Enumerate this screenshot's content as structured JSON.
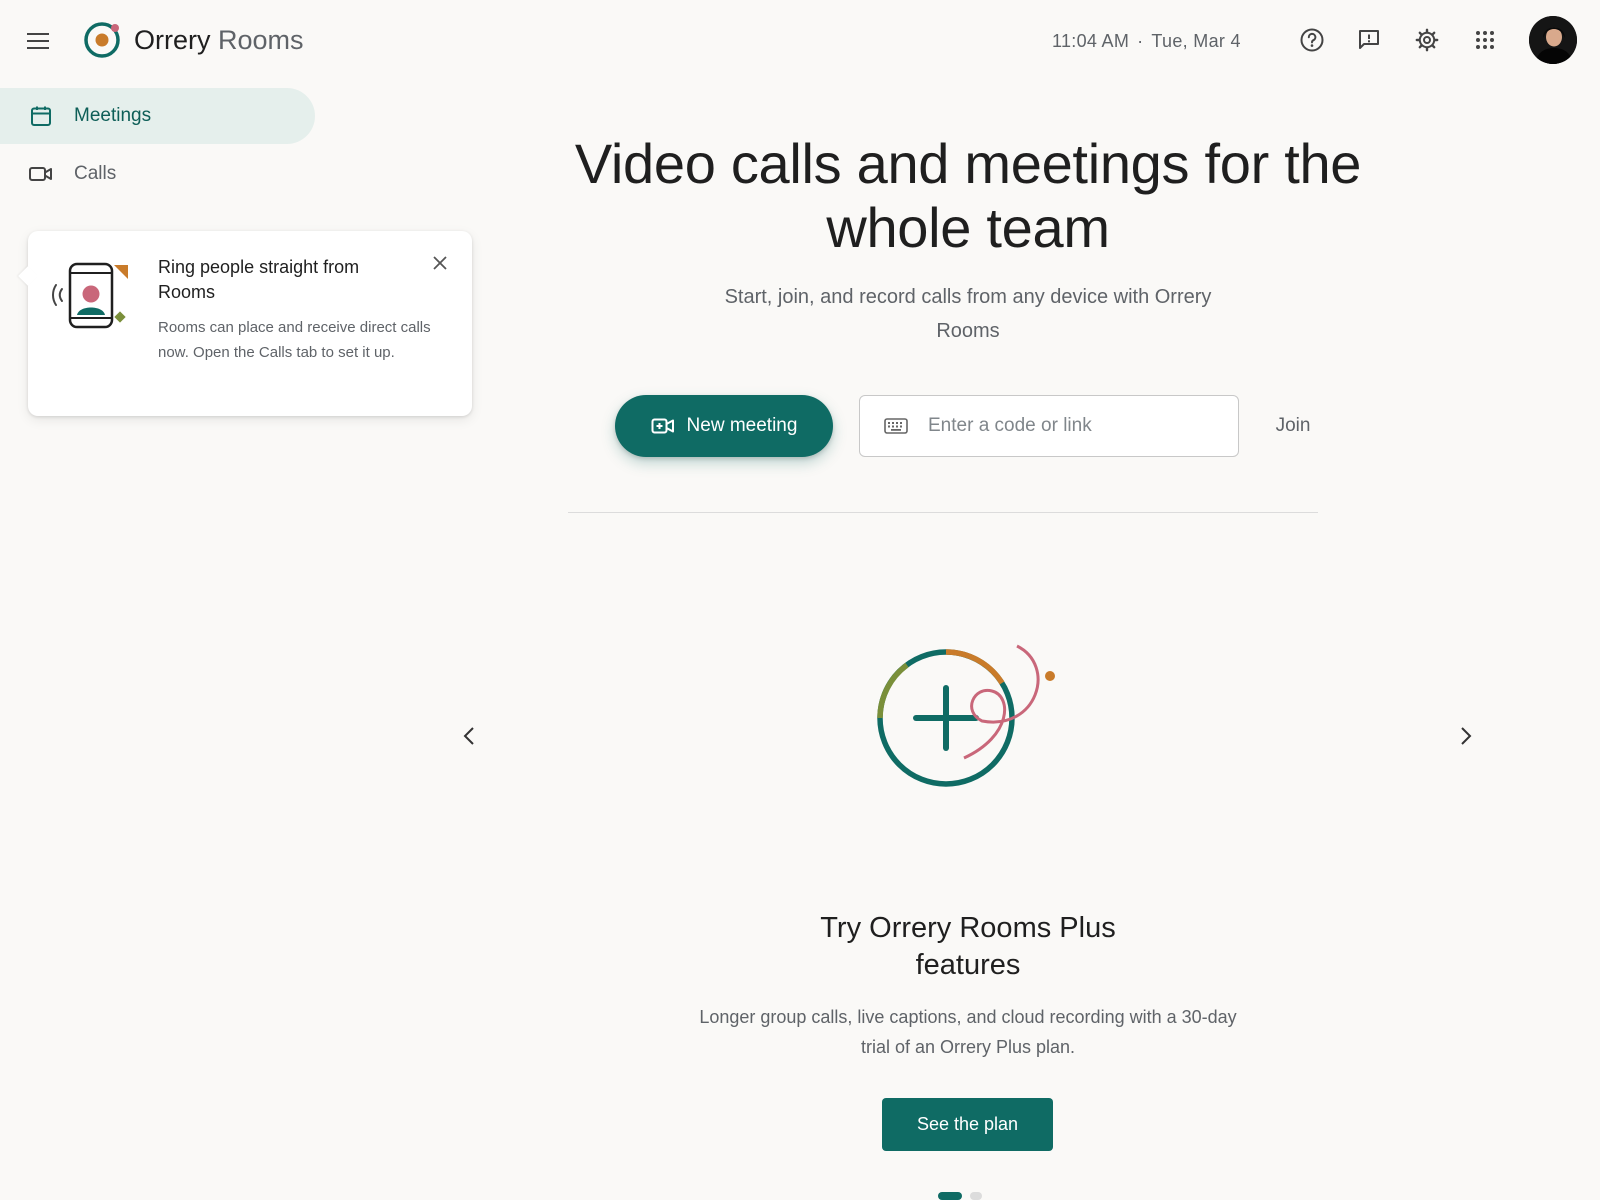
{
  "header": {
    "brand_primary": "Orrery",
    "brand_secondary": "Rooms",
    "time": "11:04 AM",
    "separator": "·",
    "date": "Tue, Mar 4",
    "icons": [
      "menu-icon",
      "help-icon",
      "feedback-icon",
      "settings-icon",
      "apps-grid-icon"
    ]
  },
  "sidebar": {
    "items": [
      {
        "label": "Meetings",
        "icon": "calendar-icon",
        "active": true
      },
      {
        "label": "Calls",
        "icon": "video-camera-icon",
        "active": false
      }
    ]
  },
  "popup": {
    "title": "Ring people straight from Rooms",
    "body": "Rooms can place and receive direct calls now. Open the Calls tab to set it up."
  },
  "hero": {
    "title": "Video calls and meetings for the whole team",
    "subtitle": "Start, join, and record calls from any device with Orrery Rooms",
    "new_meeting_label": "New meeting",
    "code_placeholder": "Enter a code or link",
    "code_value": "",
    "join_label": "Join"
  },
  "carousel": {
    "title": "Try Orrery Rooms Plus features",
    "body": "Longer group calls, live captions, and cloud recording with a 30-day trial of an Orrery Plus plan.",
    "button_label": "See the plan",
    "current_slide": 1,
    "total_slides": 2
  },
  "colors": {
    "accent": "#0f6b64",
    "accent_light": "#e5efec",
    "orange": "#c97b2a",
    "pink": "#c9677a",
    "olive": "#7a8f3a",
    "background": "#faf9f7"
  }
}
